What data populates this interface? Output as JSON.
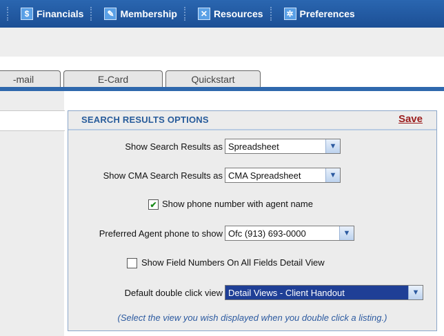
{
  "nav": {
    "items": [
      {
        "label": "Financials",
        "icon": "dollar-icon",
        "glyph": "$"
      },
      {
        "label": "Membership",
        "icon": "badge-icon",
        "glyph": "✎"
      },
      {
        "label": "Resources",
        "icon": "tools-icon",
        "glyph": "✕"
      },
      {
        "label": "Preferences",
        "icon": "gear-icon",
        "glyph": "✲"
      }
    ]
  },
  "tabs": [
    {
      "label": "-mail"
    },
    {
      "label": "E-Card"
    },
    {
      "label": "Quickstart"
    }
  ],
  "options": {
    "title": "SEARCH RESULTS OPTIONS",
    "save_label": "Save",
    "search_results_label": "Show Search Results as",
    "search_results_value": "Spreadsheet",
    "cma_results_label": "Show CMA Search Results as",
    "cma_results_value": "CMA Spreadsheet",
    "phone_checkbox_label": "Show phone number with agent name",
    "phone_checkbox_checked": true,
    "agent_phone_label": "Preferred Agent phone to show",
    "agent_phone_value": "Ofc (913) 693-0000",
    "field_numbers_label": "Show Field Numbers On All Fields Detail View",
    "field_numbers_checked": false,
    "double_click_label": "Default double click view",
    "double_click_value": "Detail Views - Client Handout",
    "hint": "(Select the view you wish displayed when you double click a listing.)"
  },
  "colors": {
    "nav_bg": "#1c4f95",
    "tab_line": "#2f68ad",
    "save_link": "#9b1c1c",
    "title": "#275b9a"
  }
}
